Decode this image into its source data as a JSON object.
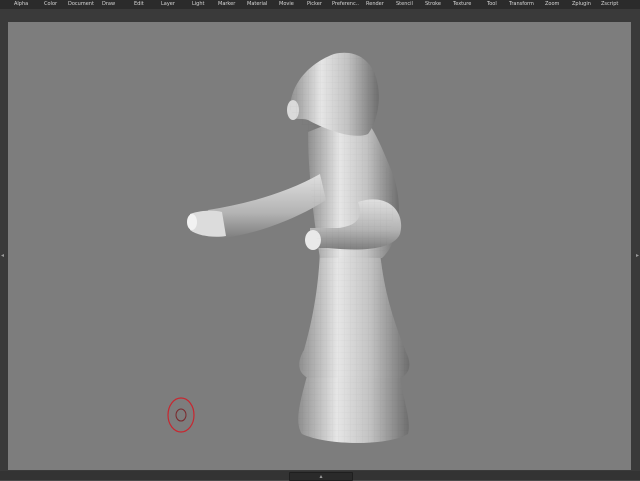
{
  "menu": {
    "items": [
      "Alpha",
      "Color",
      "Document",
      "Draw",
      "Edit",
      "Layer",
      "Light",
      "Marker",
      "Material",
      "Movie",
      "Picker",
      "Preferenc..",
      "Render",
      "Stencil",
      "Stroke",
      "Texture",
      "Tool",
      "Transform",
      "Zoom",
      "Zplugin",
      "Zscript"
    ]
  },
  "colors": {
    "canvas_bg": "#7d7d7d",
    "menubar_bg": "#2b2b2b",
    "frame_bg": "#3a3a3a",
    "model_base": "#c8c8c8",
    "brush_cursor": "#c8262f"
  },
  "icons": {
    "left_tray_handle": "triangle-left-icon",
    "right_tray_handle": "triangle-right-icon",
    "bottom_tray_handle": "triangle-up-icon"
  },
  "handles": {
    "left_glyph": "◂",
    "right_glyph": "▸",
    "bottom_glyph": "▴"
  }
}
